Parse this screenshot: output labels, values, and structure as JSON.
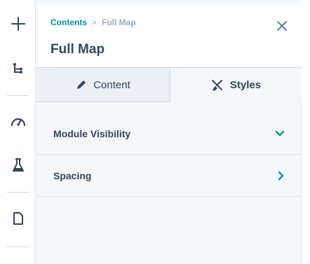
{
  "rail": {
    "items": [
      {
        "icon": "plus-icon"
      },
      {
        "icon": "tree-structure-icon"
      },
      {
        "icon": "gauge-icon"
      },
      {
        "icon": "flask-icon"
      },
      {
        "icon": "document-icon"
      }
    ]
  },
  "header": {
    "breadcrumb": {
      "link": "Contents",
      "separator": ">",
      "current": "Full Map"
    },
    "title": "Full Map",
    "close_icon": "close-icon"
  },
  "tabs": [
    {
      "label": "Content",
      "icon": "pencil-icon",
      "active": false
    },
    {
      "label": "Styles",
      "icon": "brush-icon",
      "active": true
    }
  ],
  "sections": [
    {
      "label": "Module Visibility",
      "icon": "chevron-down-icon",
      "expanded": true
    },
    {
      "label": "Spacing",
      "icon": "chevron-right-icon",
      "expanded": false
    }
  ],
  "colors": {
    "accent": "#0091ae",
    "text": "#33475b",
    "muted": "#99acc2"
  }
}
